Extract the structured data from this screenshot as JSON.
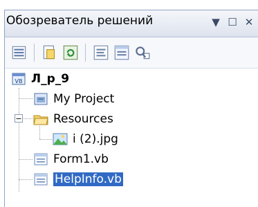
{
  "panel": {
    "title": "Обозреватель решений",
    "pin_glyph": "▼",
    "restore_glyph": "☐",
    "close_glyph": "✕"
  },
  "toolbar": {
    "items": [
      "properties-icon",
      "show-all-files-icon",
      "refresh-icon",
      "view-code-icon",
      "view-designer-icon",
      "class-diagram-icon"
    ]
  },
  "tree": {
    "project": "Л_р_9",
    "items": [
      {
        "label": "My Project",
        "icon": "my-project-icon"
      },
      {
        "label": "Resources",
        "icon": "folder-open-icon",
        "expander": "−"
      },
      {
        "label": "i (2).jpg",
        "icon": "image-file-icon"
      },
      {
        "label": "Form1.vb",
        "icon": "vb-form-icon"
      },
      {
        "label": "HelpInfo.vb",
        "icon": "vb-form-icon",
        "selected": true
      }
    ]
  }
}
